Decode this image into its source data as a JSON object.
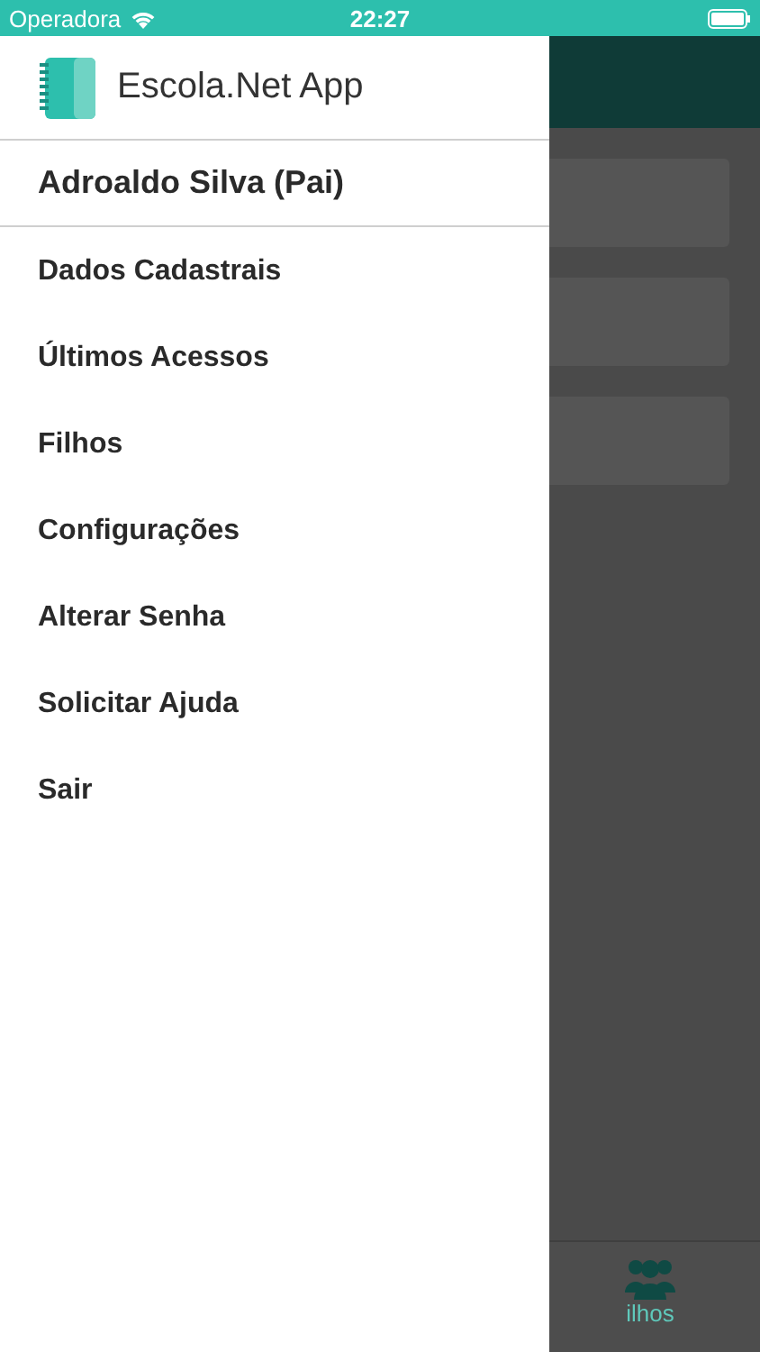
{
  "status_bar": {
    "carrier": "Operadora",
    "time": "22:27"
  },
  "background_app": {
    "cards": [
      {
        "kind": "card"
      },
      {
        "kind": "card"
      },
      {
        "kind": "card"
      }
    ],
    "tab_bar": {
      "label": "ilhos"
    }
  },
  "drawer": {
    "app_name": "Escola.Net App",
    "user_name": "Adroaldo Silva (Pai)",
    "items": [
      {
        "label": "Dados Cadastrais"
      },
      {
        "label": "Últimos Acessos"
      },
      {
        "label": "Filhos"
      },
      {
        "label": "Configurações"
      },
      {
        "label": "Alterar Senha"
      },
      {
        "label": "Solicitar Ajuda"
      },
      {
        "label": "Sair"
      }
    ]
  }
}
